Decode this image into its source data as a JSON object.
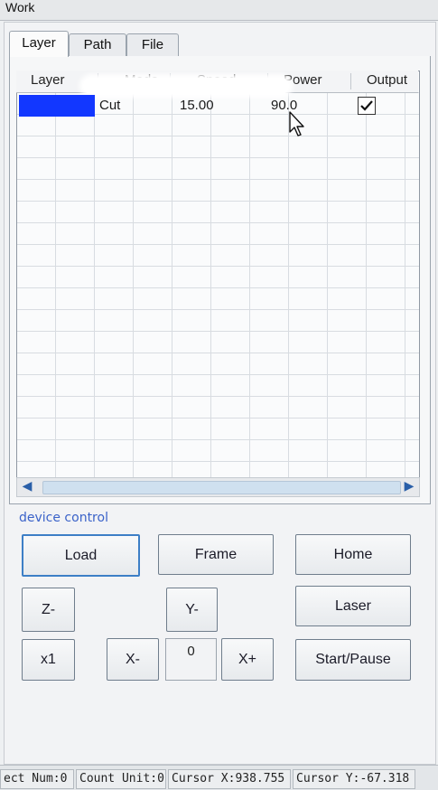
{
  "window": {
    "title": "Work"
  },
  "tabs": [
    {
      "label": "Layer",
      "active": true
    },
    {
      "label": "Path",
      "active": false
    },
    {
      "label": "File",
      "active": false
    }
  ],
  "layer_table": {
    "columns": [
      "Layer",
      "Mode",
      "Speed",
      "Power",
      "Output"
    ],
    "rows": [
      {
        "color": "#1237ff",
        "mode": "Cut",
        "speed": "15.00",
        "power": "90.0",
        "output": true
      }
    ]
  },
  "device_control": {
    "label": "device control",
    "buttons": {
      "load": "Load",
      "frame": "Frame",
      "home": "Home",
      "z_minus": "Z-",
      "y_minus": "Y-",
      "laser": "Laser",
      "x1": "x1",
      "x_minus": "X-",
      "step_value": "0",
      "x_plus": "X+",
      "start_pause": "Start/Pause"
    }
  },
  "status_bar": {
    "object_num": "ect Num:0",
    "count_unit": "Count Unit:0",
    "cursor_x": "Cursor X:938.755",
    "cursor_y": "Cursor Y:-67.318"
  }
}
